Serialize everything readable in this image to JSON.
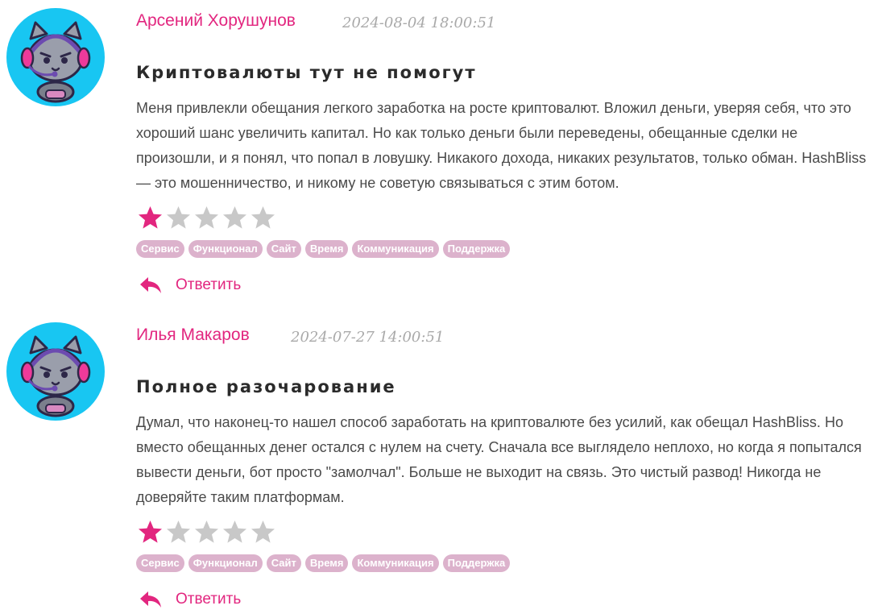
{
  "colors": {
    "accent": "#e2267f",
    "avatar_bg": "#18c6f2",
    "tag_bg": "#dcb2cc",
    "star_empty": "#c8c8c8"
  },
  "reviews": [
    {
      "author": "Арсений Хорушунов",
      "date": "2024-08-04 18:00:51",
      "title": "Криптовалюты тут не помогут",
      "text": "Меня привлекли обещания легкого заработка на росте криптовалют. Вложил деньги, уверяя себя, что это хороший шанс увеличить капитал. Но как только деньги были переведены, обещанные сделки не произошли, и я понял, что попал в ловушку. Никакого дохода, никаких результатов, только обман. HashBliss — это мошенничество, и никому не советую связываться с этим ботом.",
      "rating": 1,
      "rating_max": 5,
      "tags": [
        "Сервис",
        "Функционал",
        "Сайт",
        "Время",
        "Коммуникация",
        "Поддержка"
      ],
      "reply_label": "Ответить",
      "avatar_icon": "cat-gamer-avatar-icon"
    },
    {
      "author": "Илья Макаров",
      "date": "2024-07-27 14:00:51",
      "title": "Полное разочарование",
      "text": "Думал, что наконец-то нашел способ заработать на криптовалюте без усилий, как обещал HashBliss. Но вместо обещанных денег остался с нулем на счету. Сначала все выглядело неплохо, но когда я попытался вывести деньги, бот просто \"замолчал\". Больше не выходит на связь. Это чистый развод! Никогда не доверяйте таким платформам.",
      "rating": 1,
      "rating_max": 5,
      "tags": [
        "Сервис",
        "Функционал",
        "Сайт",
        "Время",
        "Коммуникация",
        "Поддержка"
      ],
      "reply_label": "Ответить",
      "avatar_icon": "cat-gamer-avatar-icon"
    }
  ]
}
